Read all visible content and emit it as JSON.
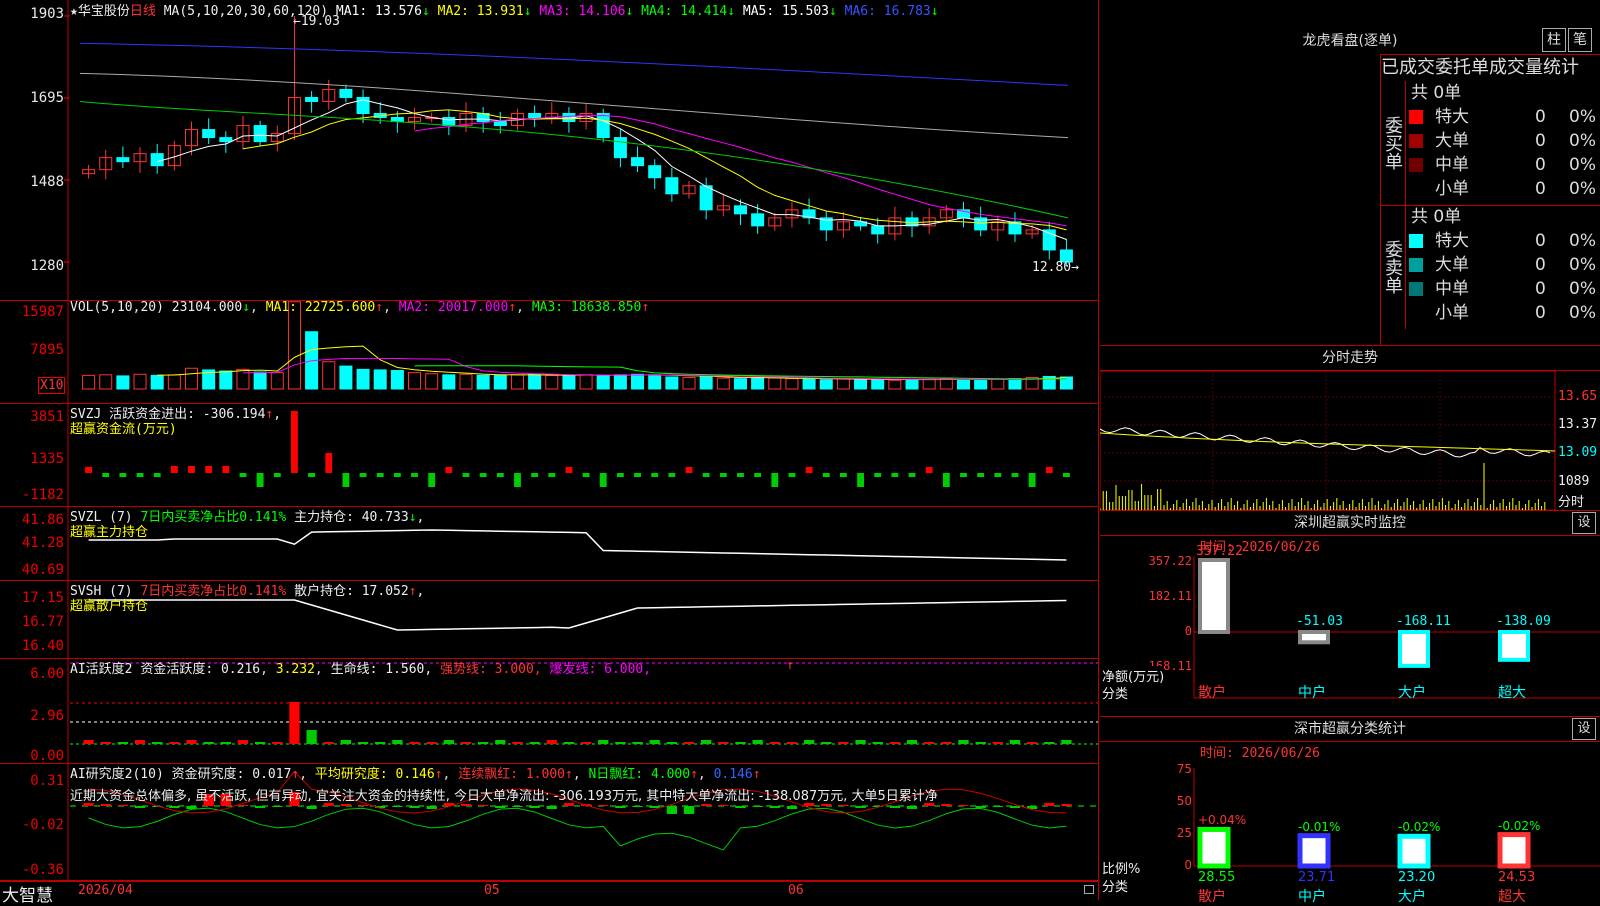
{
  "stock": {
    "star": "★",
    "name": "华宝股份",
    "period": "日线"
  },
  "kline": {
    "ma_header": "MA(5,10,20,30,60,120)",
    "ma": [
      {
        "label": "MA1: 13.576",
        "arrow": "↓",
        "color": "#ffffff"
      },
      {
        "label": "MA2: 13.931",
        "arrow": "↓",
        "color": "#ffff00"
      },
      {
        "label": "MA3: 14.106",
        "arrow": "↓",
        "color": "#ff00ff"
      },
      {
        "label": "MA4: 14.414",
        "arrow": "↓",
        "color": "#00ff00"
      },
      {
        "label": "MA5: 15.503",
        "arrow": "↓",
        "color": "#ffffff"
      },
      {
        "label": "MA6: 16.783",
        "arrow": "↓",
        "color": "#3355ff"
      }
    ],
    "y_labels": [
      "1903",
      "1695",
      "1488",
      "1280"
    ],
    "high_marker": "19.03",
    "low_marker": "12.80",
    "high": 19.03,
    "low": 12.8,
    "closes": [
      15.2,
      15.5,
      15.4,
      15.6,
      15.3,
      15.8,
      16.2,
      16.0,
      15.9,
      16.3,
      15.9,
      16.1,
      17.0,
      16.9,
      17.2,
      17.0,
      16.6,
      16.5,
      16.4,
      16.5,
      16.5,
      16.3,
      16.6,
      16.4,
      16.3,
      16.6,
      16.5,
      16.6,
      16.4,
      16.6,
      16.0,
      15.5,
      15.3,
      15.0,
      14.6,
      14.8,
      14.2,
      14.3,
      14.1,
      13.8,
      14.0,
      14.2,
      14.0,
      13.7,
      13.9,
      13.8,
      13.6,
      14.0,
      13.8,
      14.0,
      14.2,
      14.0,
      13.7,
      13.9,
      13.6,
      13.7,
      13.2,
      12.9
    ]
  },
  "vol": {
    "header": "VOL(5,10,20)",
    "value": "23104.000",
    "arrow": "↓",
    "ma1": "MA1: 22725.600",
    "ma2": "MA2: 20017.000",
    "ma3": "MA3: 18638.850",
    "y_labels": [
      "15987",
      "7895"
    ],
    "unit_label": "X10",
    "values": [
      2500,
      2600,
      2400,
      2700,
      2500,
      2600,
      3800,
      3500,
      3300,
      3600,
      3100,
      3000,
      16000,
      10500,
      5000,
      4200,
      3600,
      3500,
      3400,
      3000,
      2800,
      2600,
      2700,
      2500,
      2500,
      2600,
      2700,
      2500,
      2400,
      2600,
      2500,
      2600,
      2700,
      2600,
      2200,
      2100,
      2300,
      2000,
      1900,
      2100,
      2000,
      1900,
      1800,
      1700,
      1900,
      1800,
      1700,
      1600,
      1700,
      1800,
      1900,
      1700,
      1600,
      1800,
      1900,
      2100,
      2300,
      2200
    ]
  },
  "svzj": {
    "header": "SVZJ  活跃资金进出:",
    "value": "-306.194",
    "arrow": "↑",
    "comma": ",",
    "subtitle": "超赢资金流(万元)",
    "y_labels": [
      "3851",
      "1335",
      "-1182"
    ]
  },
  "svzl": {
    "header": "SVZL (7)",
    "green_text": "7日内买卖净占比0.141%",
    "label": "主力持仓:",
    "value": "40.733",
    "arrow": "↓",
    "comma": ",",
    "subtitle": "超赢主力持仓",
    "y_labels": [
      "41.86",
      "41.28",
      "40.69"
    ]
  },
  "svsh": {
    "header": "SVSH (7)",
    "red_text": "7日内买卖净占比0.141%",
    "label": "散户持仓:",
    "value": "17.052",
    "arrow": "↑",
    "comma": ",",
    "subtitle": "超赢散户持仓",
    "y_labels": [
      "17.15",
      "16.77",
      "16.40"
    ]
  },
  "ai_active": {
    "header": "AI活跃度2",
    "label": "资金活跃度:",
    "value": "0.216",
    "v2": "3.232",
    "life": "生命线: 1.560,",
    "strong": "强势线: 3.000,",
    "burst": "爆发线: 6.000,",
    "arrow": "↑",
    "y_labels": [
      "6.00",
      "2.96",
      "0.00"
    ]
  },
  "ai_research": {
    "header": "AI研究度2(10)",
    "label": "资金研究度:",
    "value": "0.017",
    "arrow": "↑",
    "avg": "平均研究度: 0.146",
    "cont": "连续飘红: 1.000",
    "nday": "N日飘红: 4.000",
    "last": "0.146",
    "comment": "近期大资金总体偏多, 虽不活跃, 但有异动, 宜关注大资金的持续性, 今日大单净流出: -306.193万元, 其中特大单净流出: -138.087万元, 大单5日累计净",
    "y_labels": [
      "0.31",
      "-0.02",
      "-0.36"
    ]
  },
  "xaxis": {
    "labels": [
      "2026/04",
      "05",
      "06"
    ]
  },
  "app": {
    "name": "大智慧"
  },
  "dragon": {
    "title": "龙虎看盘(逐单)",
    "btn_bar": "柱",
    "btn_pen": "笔",
    "tabs": [
      "已成交",
      "委托单",
      "成交量统计"
    ],
    "buy": {
      "side": "委买单",
      "total": "共 0单",
      "rows": [
        {
          "name": "特大",
          "val": "0",
          "pct": "0%",
          "color": "#ff0000"
        },
        {
          "name": "大单",
          "val": "0",
          "pct": "0%",
          "color": "#a00000"
        },
        {
          "name": "中单",
          "val": "0",
          "pct": "0%",
          "color": "#700000"
        },
        {
          "name": "小单",
          "val": "0",
          "pct": "0%",
          "color": "#000000"
        }
      ]
    },
    "sell": {
      "side": "委卖单",
      "total": "共 0单",
      "rows": [
        {
          "name": "特大",
          "val": "0",
          "pct": "0%",
          "color": "#00ffff"
        },
        {
          "name": "大单",
          "val": "0",
          "pct": "0%",
          "color": "#00a0a0"
        },
        {
          "name": "中单",
          "val": "0",
          "pct": "0%",
          "color": "#007878"
        },
        {
          "name": "小单",
          "val": "0",
          "pct": "0%",
          "color": "#000000"
        }
      ]
    }
  },
  "intraday": {
    "title": "分时走势",
    "prices": [
      "13.65",
      "13.37",
      "13.09"
    ],
    "vol_label": "1089",
    "vol_unit": "分时"
  },
  "monitor": {
    "title": "深圳超赢实时监控",
    "set": "设",
    "time": "时间: 2026/06/26",
    "y_labels": [
      "357.22",
      "182.11",
      "0",
      "-168.11"
    ],
    "ylabel": "净额(万元)",
    "xlabel": "分类",
    "cats": [
      "散户",
      "中户",
      "大户",
      "超大"
    ],
    "values": [
      357.22,
      -51.03,
      -168.11,
      -138.09
    ],
    "value_labels": [
      "357.22",
      "-51.03",
      "-168.11",
      "-138.09"
    ]
  },
  "classify": {
    "title": "深市超赢分类统计",
    "set": "设",
    "time": "时间: 2026/06/26",
    "y_labels": [
      "75",
      "50",
      "25",
      "0"
    ],
    "ylabel": "比例%",
    "xlabel": "分类",
    "cats": [
      "散户",
      "中户",
      "大户",
      "超大"
    ],
    "values": [
      28.55,
      23.71,
      23.2,
      24.53
    ],
    "value_labels": [
      "28.55",
      "23.71",
      "23.20",
      "24.53"
    ],
    "change_labels": [
      "+0.04%",
      "-0.01%",
      "-0.02%",
      "-0.02%"
    ]
  }
}
